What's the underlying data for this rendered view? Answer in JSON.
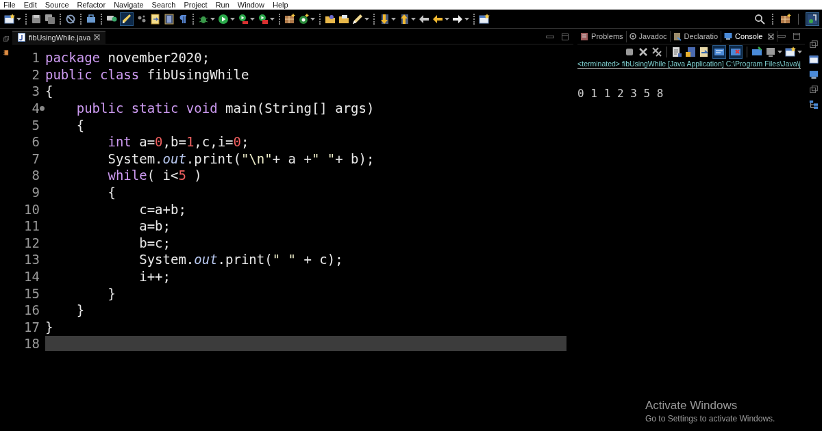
{
  "menu": [
    "File",
    "Edit",
    "Source",
    "Refactor",
    "Navigate",
    "Search",
    "Project",
    "Run",
    "Window",
    "Help"
  ],
  "toolbar": {
    "toggles": [
      {
        "selected": true
      }
    ]
  },
  "editor": {
    "tab": {
      "label": "fibUsingWhile.java",
      "selected": true
    },
    "lines": [
      {
        "number": "1",
        "current": false,
        "marker": false,
        "tokens": [
          {
            "kind": "kw",
            "text": "package"
          },
          {
            "kind": "plain",
            "text": " november2020;"
          }
        ]
      },
      {
        "number": "2",
        "current": false,
        "marker": false,
        "tokens": [
          {
            "kind": "kw",
            "text": "public class"
          },
          {
            "kind": "plain",
            "text": " fibUsingWhile"
          }
        ]
      },
      {
        "number": "3",
        "current": false,
        "marker": false,
        "tokens": [
          {
            "kind": "plain",
            "text": "{"
          }
        ]
      },
      {
        "number": "4",
        "current": false,
        "marker": true,
        "tokens": [
          {
            "kind": "kw",
            "text": "    public static void"
          },
          {
            "kind": "plain",
            "text": " main(String[] args)"
          }
        ]
      },
      {
        "number": "5",
        "current": false,
        "marker": false,
        "tokens": [
          {
            "kind": "plain",
            "text": "    {"
          }
        ]
      },
      {
        "number": "6",
        "current": false,
        "marker": false,
        "tokens": [
          {
            "kind": "kw",
            "text": "        int"
          },
          {
            "kind": "plain",
            "text": " a="
          },
          {
            "kind": "num",
            "text": "0"
          },
          {
            "kind": "plain",
            "text": ",b="
          },
          {
            "kind": "num",
            "text": "1"
          },
          {
            "kind": "plain",
            "text": ",c,i="
          },
          {
            "kind": "num",
            "text": "0"
          },
          {
            "kind": "plain",
            "text": ";"
          }
        ]
      },
      {
        "number": "7",
        "current": false,
        "marker": false,
        "tokens": [
          {
            "kind": "plain",
            "text": "        System."
          },
          {
            "kind": "field",
            "text": "out"
          },
          {
            "kind": "plain",
            "text": ".print("
          },
          {
            "kind": "str",
            "text": "\"\\n\""
          },
          {
            "kind": "plain",
            "text": "+ a +"
          },
          {
            "kind": "str",
            "text": "\" \""
          },
          {
            "kind": "plain",
            "text": "+ b);"
          }
        ]
      },
      {
        "number": "8",
        "current": false,
        "marker": false,
        "tokens": [
          {
            "kind": "kw",
            "text": "        while"
          },
          {
            "kind": "plain",
            "text": "( i<"
          },
          {
            "kind": "num",
            "text": "5"
          },
          {
            "kind": "plain",
            "text": " )"
          }
        ]
      },
      {
        "number": "9",
        "current": false,
        "marker": false,
        "tokens": [
          {
            "kind": "plain",
            "text": "        {"
          }
        ]
      },
      {
        "number": "10",
        "current": false,
        "marker": false,
        "tokens": [
          {
            "kind": "plain",
            "text": "            c=a+b;"
          }
        ]
      },
      {
        "number": "11",
        "current": false,
        "marker": false,
        "tokens": [
          {
            "kind": "plain",
            "text": "            a=b;"
          }
        ]
      },
      {
        "number": "12",
        "current": false,
        "marker": false,
        "tokens": [
          {
            "kind": "plain",
            "text": "            b=c;"
          }
        ]
      },
      {
        "number": "13",
        "current": false,
        "marker": false,
        "tokens": [
          {
            "kind": "plain",
            "text": "            System."
          },
          {
            "kind": "field",
            "text": "out"
          },
          {
            "kind": "plain",
            "text": ".print("
          },
          {
            "kind": "str",
            "text": "\" \""
          },
          {
            "kind": "plain",
            "text": " + c);"
          }
        ]
      },
      {
        "number": "14",
        "current": false,
        "marker": false,
        "tokens": [
          {
            "kind": "plain",
            "text": "            i++;"
          }
        ]
      },
      {
        "number": "15",
        "current": false,
        "marker": false,
        "tokens": [
          {
            "kind": "plain",
            "text": "        }"
          }
        ]
      },
      {
        "number": "16",
        "current": false,
        "marker": false,
        "tokens": [
          {
            "kind": "plain",
            "text": "    }"
          }
        ]
      },
      {
        "number": "17",
        "current": false,
        "marker": false,
        "tokens": [
          {
            "kind": "plain",
            "text": "}"
          }
        ]
      },
      {
        "number": "18",
        "current": true,
        "marker": false
      }
    ]
  },
  "console": {
    "tabs": [
      {
        "label": "Problems",
        "selected": false
      },
      {
        "label": "Javadoc",
        "selected": false
      },
      {
        "label": "Declaratio",
        "selected": false
      },
      {
        "label": "Console",
        "selected": true
      }
    ],
    "toggles": [
      {
        "selected": true
      },
      {
        "selected": true
      }
    ],
    "status": "<terminated> fibUsingWhile [Java Application] C:\\Program Files\\Java\\j",
    "output": "0 1 1 2 3 5 8"
  },
  "activation": {
    "title": "Activate Windows",
    "message": "Go to Settings to activate Windows."
  }
}
